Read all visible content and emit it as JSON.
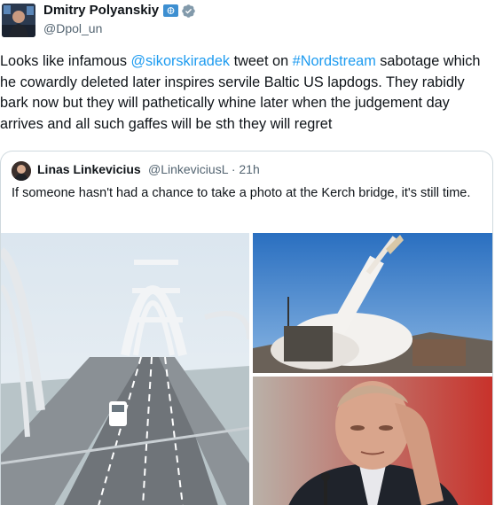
{
  "author": {
    "name": "Dmitry Polyanskiy",
    "handle": "@Dpol_un",
    "badges": [
      "un-flag-icon",
      "verified-icon"
    ]
  },
  "tweet": {
    "text_parts": [
      {
        "t": "Looks like infamous ",
        "link": false
      },
      {
        "t": "@sikorskiradek",
        "link": true
      },
      {
        "t": " tweet on ",
        "link": false
      },
      {
        "t": "#Nordstream",
        "link": true
      },
      {
        "t": " sabotage which he cowardly deleted later inspires servile Baltic US lapdogs. They rabidly bark now but they will pathetically whine later when the judgement day arrives and all such gaffes will be sth they will regret",
        "link": false
      }
    ]
  },
  "quote": {
    "name": "Linas Linkevicius",
    "handle_time": "@LinkeviciusL · 21h",
    "text": "If someone hasn't had a chance to take a photo at the Kerch bridge, it's still time.",
    "images": [
      {
        "name": "kerch-bridge-photo"
      },
      {
        "name": "missile-launch-photo"
      },
      {
        "name": "putin-photo"
      }
    ]
  },
  "colors": {
    "link": "#1d9bf0",
    "secondary_text": "#536471",
    "border": "#cfd9de",
    "verified": "#1d9bf0"
  }
}
